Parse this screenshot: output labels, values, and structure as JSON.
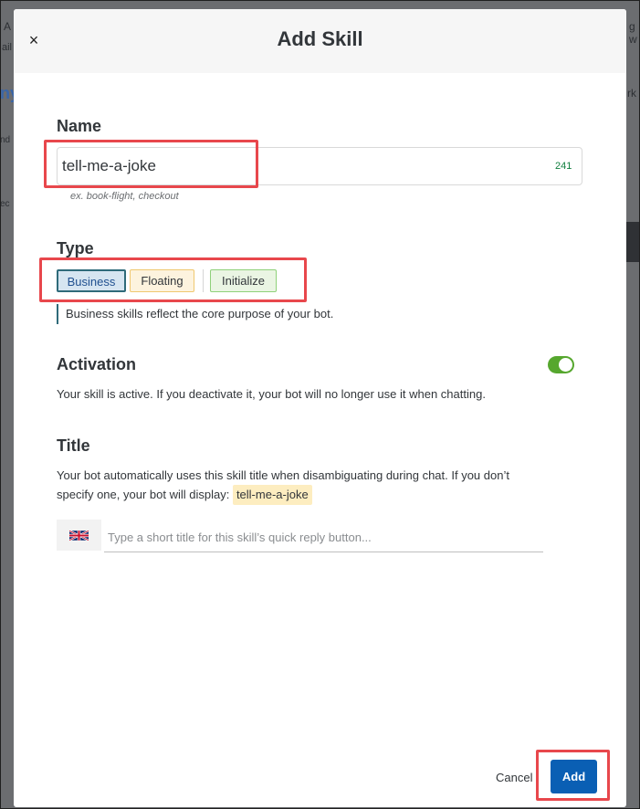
{
  "background": {
    "frag1": "A",
    "frag2": "ny",
    "frag3": "nd",
    "frag4": "ec",
    "frag5": "g w",
    "frag6": "rk",
    "frag7": "ail"
  },
  "modal": {
    "title": "Add Skill",
    "close_label": "×"
  },
  "name_section": {
    "label": "Name",
    "value": "tell-me-a-joke",
    "counter": "241",
    "hint": "ex. book-flight, checkout"
  },
  "type_section": {
    "label": "Type",
    "options": [
      {
        "label": "Business",
        "selected": true
      },
      {
        "label": "Floating",
        "selected": false
      },
      {
        "label": "Initialize",
        "selected": false
      }
    ],
    "description": "Business skills reflect the core purpose of your bot."
  },
  "activation_section": {
    "label": "Activation",
    "enabled": true,
    "description": "Your skill is active. If you deactivate it, your bot will no longer use it when chatting."
  },
  "title_section": {
    "label": "Title",
    "description_line1": "Your bot automatically uses this skill title when disambiguating during chat. If you don’t",
    "description_line2": "specify one, your bot will display:",
    "default_title": "tell-me-a-joke",
    "language_icon": "uk-flag-icon",
    "placeholder": "Type a short title for this skill’s quick reply button..."
  },
  "footer": {
    "cancel_label": "Cancel",
    "add_label": "Add"
  },
  "colors": {
    "primary": "#0a5fb4",
    "toggle_on": "#56a72e",
    "highlight": "#e8474c"
  }
}
